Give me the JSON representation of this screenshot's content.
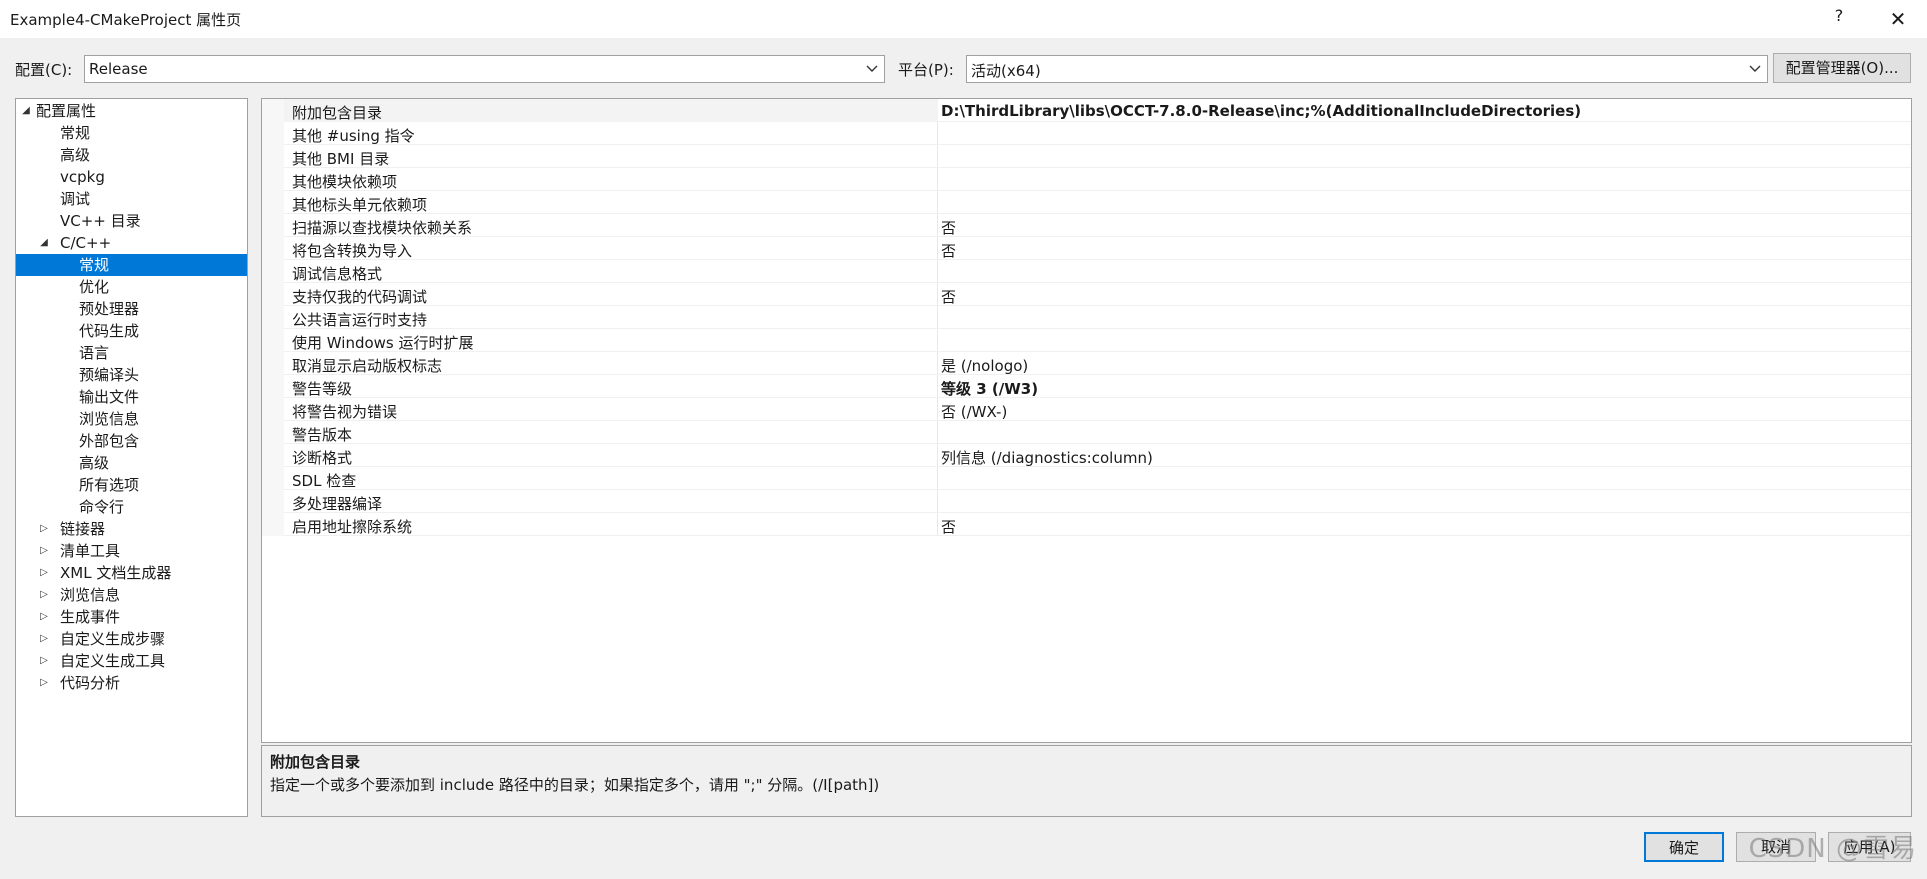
{
  "window": {
    "title": "Example4-CMakeProject 属性页",
    "help_label": "?",
    "close_label": "✕"
  },
  "toolbar": {
    "config_label": "配置(C):",
    "config_value": "Release",
    "platform_label": "平台(P):",
    "platform_value": "活动(x64)",
    "config_manager_label": "配置管理器(O)..."
  },
  "tree": {
    "items": [
      {
        "label": "配置属性",
        "twisty": "◢"
      },
      {
        "label": "常规"
      },
      {
        "label": "高级"
      },
      {
        "label": "vcpkg"
      },
      {
        "label": "调试"
      },
      {
        "label": "VC++ 目录"
      },
      {
        "label": "C/C++",
        "twisty": "◢"
      },
      {
        "label": "常规"
      },
      {
        "label": "优化"
      },
      {
        "label": "预处理器"
      },
      {
        "label": "代码生成"
      },
      {
        "label": "语言"
      },
      {
        "label": "预编译头"
      },
      {
        "label": "输出文件"
      },
      {
        "label": "浏览信息"
      },
      {
        "label": "外部包含"
      },
      {
        "label": "高级"
      },
      {
        "label": "所有选项"
      },
      {
        "label": "命令行"
      },
      {
        "label": "链接器",
        "twisty": "▷"
      },
      {
        "label": "清单工具",
        "twisty": "▷"
      },
      {
        "label": "XML 文档生成器",
        "twisty": "▷"
      },
      {
        "label": "浏览信息",
        "twisty": "▷"
      },
      {
        "label": "生成事件",
        "twisty": "▷"
      },
      {
        "label": "自定义生成步骤",
        "twisty": "▷"
      },
      {
        "label": "自定义生成工具",
        "twisty": "▷"
      },
      {
        "label": "代码分析",
        "twisty": "▷"
      }
    ]
  },
  "grid": {
    "rows": [
      {
        "name": "附加包含目录",
        "value": "D:\\ThirdLibrary\\libs\\OCCT-7.8.0-Release\\inc;%(AdditionalIncludeDirectories)",
        "bold": true
      },
      {
        "name": "其他 #using 指令",
        "value": ""
      },
      {
        "name": "其他 BMI 目录",
        "value": ""
      },
      {
        "name": "其他模块依赖项",
        "value": ""
      },
      {
        "name": "其他标头单元依赖项",
        "value": ""
      },
      {
        "name": "扫描源以查找模块依赖关系",
        "value": "否"
      },
      {
        "name": "将包含转换为导入",
        "value": "否"
      },
      {
        "name": "调试信息格式",
        "value": ""
      },
      {
        "name": "支持仅我的代码调试",
        "value": "否"
      },
      {
        "name": "公共语言运行时支持",
        "value": ""
      },
      {
        "name": "使用 Windows 运行时扩展",
        "value": ""
      },
      {
        "name": "取消显示启动版权标志",
        "value": "是 (/nologo)"
      },
      {
        "name": "警告等级",
        "value": "等级 3 (/W3)",
        "bold": true
      },
      {
        "name": "将警告视为错误",
        "value": "否 (/WX-)"
      },
      {
        "name": "警告版本",
        "value": ""
      },
      {
        "name": "诊断格式",
        "value": "列信息 (/diagnostics:column)"
      },
      {
        "name": "SDL 检查",
        "value": ""
      },
      {
        "name": "多处理器编译",
        "value": ""
      },
      {
        "name": "启用地址擦除系统",
        "value": "否"
      }
    ]
  },
  "description": {
    "title": "附加包含目录",
    "text": "指定一个或多个要添加到 include 路径中的目录；如果指定多个，请用 \";\" 分隔。(/I[path])"
  },
  "buttons": {
    "ok": "确定",
    "cancel": "取消",
    "apply": "应用(A)"
  },
  "watermark": "CSDN @雪易"
}
